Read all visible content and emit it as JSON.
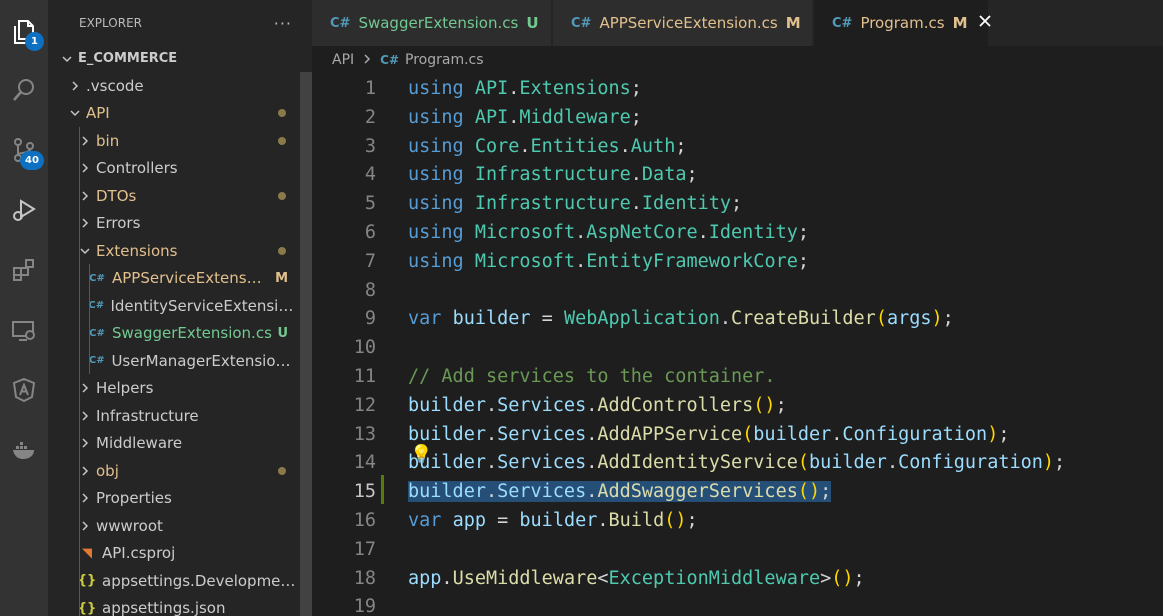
{
  "activity_bar": {
    "explorer_badge": "1",
    "scm_badge": "40",
    "icons": [
      "files-icon",
      "search-icon",
      "source-control-icon",
      "run-debug-icon",
      "extensions-icon",
      "remote-explorer-icon",
      "angular-icon",
      "docker-icon"
    ]
  },
  "sidebar": {
    "title": "EXPLORER",
    "more": "···",
    "root": "E_COMMERCE",
    "items": [
      {
        "label": ".vscode",
        "type": "folder",
        "open": false,
        "status": "",
        "dot": false
      },
      {
        "label": "API",
        "type": "folder",
        "open": true,
        "status": "",
        "dot": true
      },
      {
        "label": "bin",
        "type": "folder",
        "open": false,
        "status": "",
        "dot": true
      },
      {
        "label": "Controllers",
        "type": "folder",
        "open": false,
        "status": "",
        "dot": false
      },
      {
        "label": "DTOs",
        "type": "folder",
        "open": false,
        "status": "",
        "dot": true
      },
      {
        "label": "Errors",
        "type": "folder",
        "open": false,
        "status": "",
        "dot": false
      },
      {
        "label": "Extensions",
        "type": "folder",
        "open": true,
        "status": "",
        "dot": true
      },
      {
        "label": "APPServiceExtensio...",
        "type": "cs",
        "status": "M",
        "dot": false
      },
      {
        "label": "IdentityServiceExtension.cs",
        "type": "cs",
        "status": "",
        "dot": false
      },
      {
        "label": "SwaggerExtension.cs",
        "type": "cs",
        "status": "U",
        "dot": false
      },
      {
        "label": "UserManagerExtension.cs",
        "type": "cs",
        "status": "",
        "dot": false
      },
      {
        "label": "Helpers",
        "type": "folder",
        "open": false,
        "status": "",
        "dot": false
      },
      {
        "label": "Infrastructure",
        "type": "folder",
        "open": false,
        "status": "",
        "dot": false
      },
      {
        "label": "Middleware",
        "type": "folder",
        "open": false,
        "status": "",
        "dot": false
      },
      {
        "label": "obj",
        "type": "folder",
        "open": false,
        "status": "",
        "dot": true
      },
      {
        "label": "Properties",
        "type": "folder",
        "open": false,
        "status": "",
        "dot": false
      },
      {
        "label": "wwwroot",
        "type": "folder",
        "open": false,
        "status": "",
        "dot": false
      },
      {
        "label": "API.csproj",
        "type": "rss",
        "status": "",
        "dot": false
      },
      {
        "label": "appsettings.Development.j...",
        "type": "json",
        "status": "",
        "dot": false
      },
      {
        "label": "appsettings.json",
        "type": "json",
        "status": "",
        "dot": false
      }
    ]
  },
  "tabs": [
    {
      "label": "SwaggerExtension.cs",
      "status": "U",
      "active": false,
      "color": "#73c991"
    },
    {
      "label": "APPServiceExtension.cs",
      "status": "M",
      "active": false,
      "color": "#e2c08d"
    },
    {
      "label": "Program.cs",
      "status": "M",
      "active": true,
      "color": "#e2c08d"
    }
  ],
  "breadcrumb": {
    "folder": "API",
    "file": "Program.cs"
  },
  "editor": {
    "current_line": 15,
    "lines": [
      {
        "n": "1",
        "tokens": [
          [
            "kw",
            "using"
          ],
          [
            "tx",
            " "
          ],
          [
            "ns",
            "API"
          ],
          [
            "tx",
            "."
          ],
          [
            "ns",
            "Extensions"
          ],
          [
            "tx",
            ";"
          ]
        ]
      },
      {
        "n": "2",
        "tokens": [
          [
            "kw",
            "using"
          ],
          [
            "tx",
            " "
          ],
          [
            "ns",
            "API"
          ],
          [
            "tx",
            "."
          ],
          [
            "ns",
            "Middleware"
          ],
          [
            "tx",
            ";"
          ]
        ]
      },
      {
        "n": "3",
        "tokens": [
          [
            "kw",
            "using"
          ],
          [
            "tx",
            " "
          ],
          [
            "ns",
            "Core"
          ],
          [
            "tx",
            "."
          ],
          [
            "ns",
            "Entities"
          ],
          [
            "tx",
            "."
          ],
          [
            "ns",
            "Auth"
          ],
          [
            "tx",
            ";"
          ]
        ]
      },
      {
        "n": "4",
        "tokens": [
          [
            "kw",
            "using"
          ],
          [
            "tx",
            " "
          ],
          [
            "ns",
            "Infrastructure"
          ],
          [
            "tx",
            "."
          ],
          [
            "ns",
            "Data"
          ],
          [
            "tx",
            ";"
          ]
        ]
      },
      {
        "n": "5",
        "tokens": [
          [
            "kw",
            "using"
          ],
          [
            "tx",
            " "
          ],
          [
            "ns",
            "Infrastructure"
          ],
          [
            "tx",
            "."
          ],
          [
            "ns",
            "Identity"
          ],
          [
            "tx",
            ";"
          ]
        ]
      },
      {
        "n": "6",
        "tokens": [
          [
            "kw",
            "using"
          ],
          [
            "tx",
            " "
          ],
          [
            "ns",
            "Microsoft"
          ],
          [
            "tx",
            "."
          ],
          [
            "ns",
            "AspNetCore"
          ],
          [
            "tx",
            "."
          ],
          [
            "ns",
            "Identity"
          ],
          [
            "tx",
            ";"
          ]
        ]
      },
      {
        "n": "7",
        "tokens": [
          [
            "kw",
            "using"
          ],
          [
            "tx",
            " "
          ],
          [
            "ns",
            "Microsoft"
          ],
          [
            "tx",
            "."
          ],
          [
            "ns",
            "EntityFrameworkCore"
          ],
          [
            "tx",
            ";"
          ]
        ]
      },
      {
        "n": "8",
        "tokens": []
      },
      {
        "n": "9",
        "tokens": [
          [
            "kw",
            "var"
          ],
          [
            "tx",
            " "
          ],
          [
            "var",
            "builder"
          ],
          [
            "tx",
            " = "
          ],
          [
            "ns",
            "WebApplication"
          ],
          [
            "tx",
            "."
          ],
          [
            "fn",
            "CreateBuilder"
          ],
          [
            "br1",
            "("
          ],
          [
            "var",
            "args"
          ],
          [
            "br1",
            ")"
          ],
          [
            "tx",
            ";"
          ]
        ]
      },
      {
        "n": "10",
        "tokens": []
      },
      {
        "n": "11",
        "tokens": [
          [
            "cm",
            "// Add services to the container."
          ]
        ]
      },
      {
        "n": "12",
        "tokens": [
          [
            "var",
            "builder"
          ],
          [
            "tx",
            "."
          ],
          [
            "var",
            "Services"
          ],
          [
            "tx",
            "."
          ],
          [
            "fn",
            "AddControllers"
          ],
          [
            "br1",
            "()"
          ],
          [
            "tx",
            ";"
          ]
        ]
      },
      {
        "n": "13",
        "tokens": [
          [
            "var",
            "builder"
          ],
          [
            "tx",
            "."
          ],
          [
            "var",
            "Services"
          ],
          [
            "tx",
            "."
          ],
          [
            "fn",
            "AddAPPService"
          ],
          [
            "br1",
            "("
          ],
          [
            "var",
            "builder"
          ],
          [
            "tx",
            "."
          ],
          [
            "var",
            "Configuration"
          ],
          [
            "br1",
            ")"
          ],
          [
            "tx",
            ";"
          ]
        ]
      },
      {
        "n": "14",
        "tokens": [
          [
            "var",
            "builder"
          ],
          [
            "tx",
            "."
          ],
          [
            "var",
            "Services"
          ],
          [
            "tx",
            "."
          ],
          [
            "fn",
            "AddIdentityService"
          ],
          [
            "br1",
            "("
          ],
          [
            "var",
            "builder"
          ],
          [
            "tx",
            "."
          ],
          [
            "var",
            "Configuration"
          ],
          [
            "br1",
            ")"
          ],
          [
            "tx",
            ";"
          ]
        ]
      },
      {
        "n": "15",
        "tokens": [
          [
            "var",
            "builder"
          ],
          [
            "tx",
            "."
          ],
          [
            "var",
            "Services"
          ],
          [
            "tx",
            "."
          ],
          [
            "fn",
            "AddSwaggerServices"
          ],
          [
            "br1",
            "()"
          ],
          [
            "tx",
            ";"
          ]
        ],
        "selected": true
      },
      {
        "n": "16",
        "tokens": [
          [
            "kw",
            "var"
          ],
          [
            "tx",
            " "
          ],
          [
            "var",
            "app"
          ],
          [
            "tx",
            " = "
          ],
          [
            "var",
            "builder"
          ],
          [
            "tx",
            "."
          ],
          [
            "fn",
            "Build"
          ],
          [
            "br1",
            "()"
          ],
          [
            "tx",
            ";"
          ]
        ]
      },
      {
        "n": "17",
        "tokens": []
      },
      {
        "n": "18",
        "tokens": [
          [
            "var",
            "app"
          ],
          [
            "tx",
            "."
          ],
          [
            "fn",
            "UseMiddleware"
          ],
          [
            "tx",
            "<"
          ],
          [
            "ns",
            "ExceptionMiddleware"
          ],
          [
            "tx",
            ">"
          ],
          [
            "br1",
            "()"
          ],
          [
            "tx",
            ";"
          ]
        ]
      },
      {
        "n": "19",
        "tokens": []
      }
    ]
  }
}
